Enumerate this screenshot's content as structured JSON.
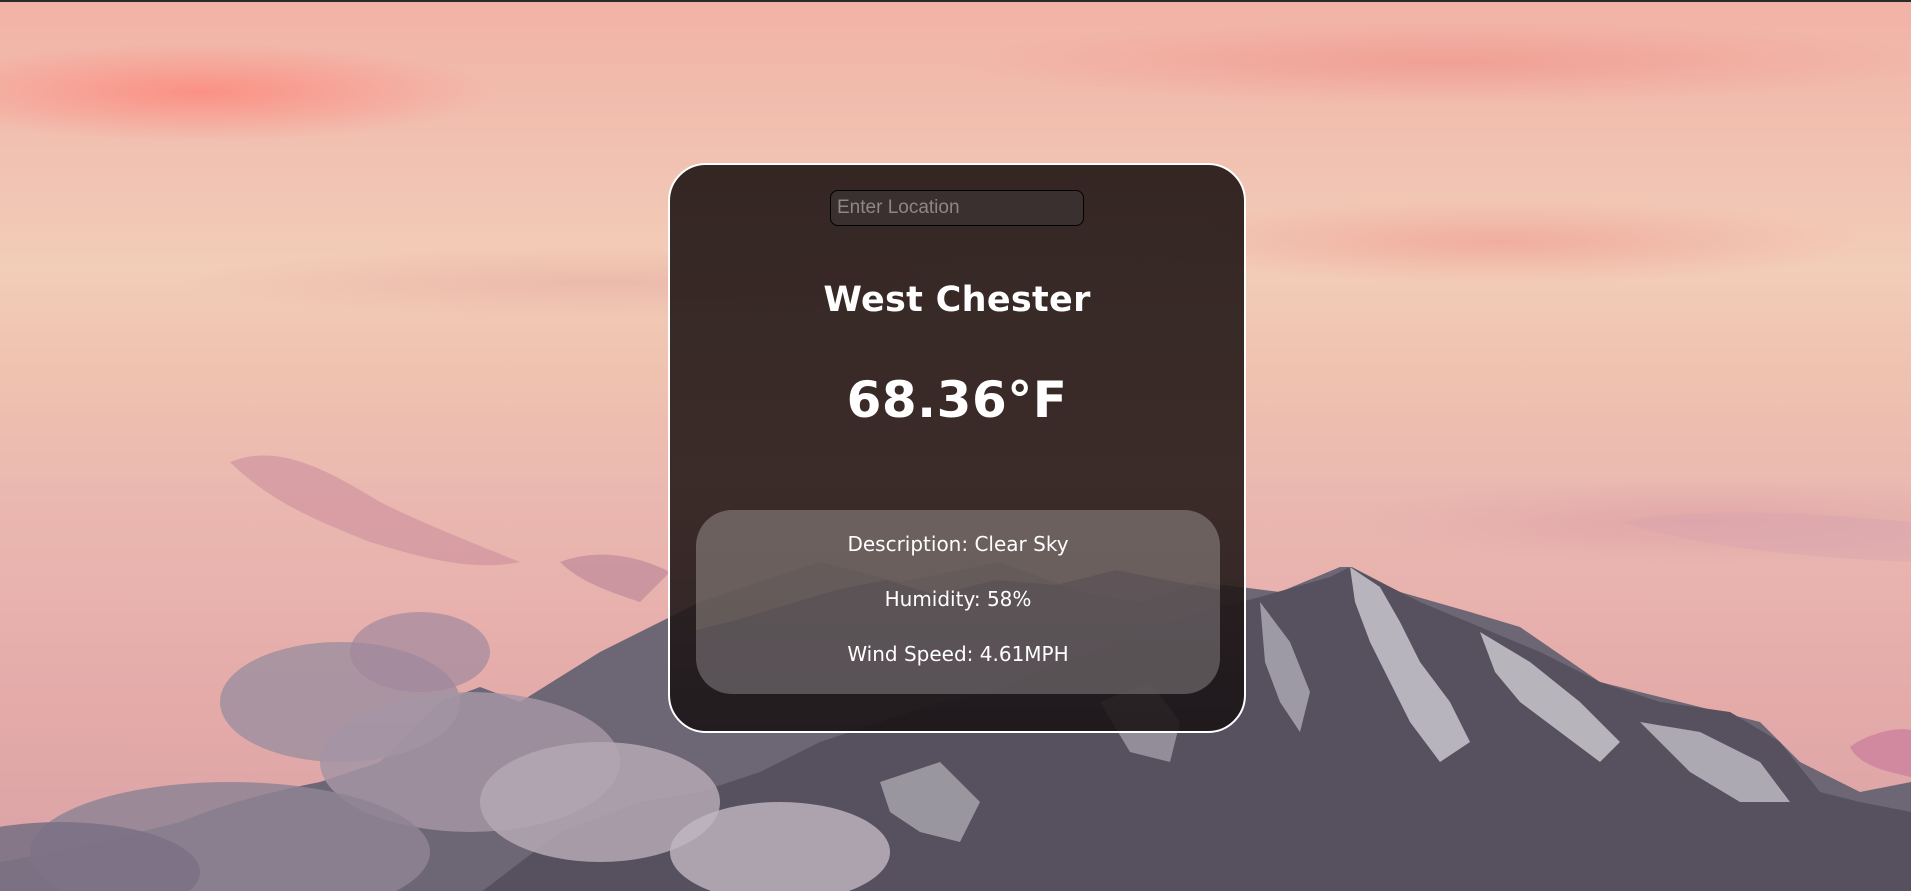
{
  "search": {
    "placeholder": "Enter Location",
    "value": ""
  },
  "weather": {
    "city": "West Chester",
    "temperature": "68.36°F",
    "description_label": "Description:",
    "description_value": "Clear Sky",
    "humidity_label": "Humidity:",
    "humidity_value": "58%",
    "wind_label": "Wind Speed:",
    "wind_value": "4.61MPH"
  },
  "colors": {
    "card_border": "#ffffff",
    "card_background": "#2a1d1b",
    "text": "#ffffff",
    "sky_top": "#f1b3a6",
    "sky_mid": "#f2cdb7",
    "mountain": "#5a5566"
  }
}
